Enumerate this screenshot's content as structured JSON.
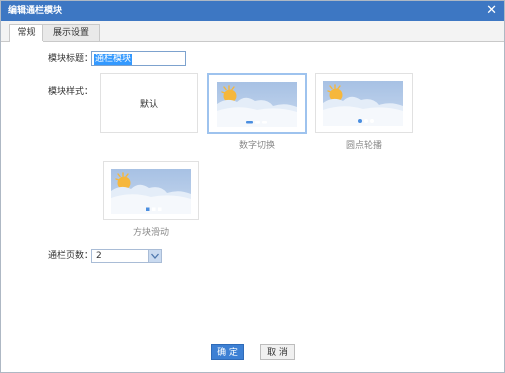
{
  "dialog": {
    "title": "编辑通栏模块"
  },
  "tabs": [
    {
      "label": "常规"
    },
    {
      "label": "展示设置"
    }
  ],
  "form": {
    "title_label": "模块标题：",
    "title_value": "通栏模块",
    "style_label": "模块样式：",
    "styles": [
      {
        "label": "默认",
        "caption": ""
      },
      {
        "label": "",
        "caption": "数字切换",
        "selected": true
      },
      {
        "label": "",
        "caption": "圆点轮播"
      },
      {
        "label": "",
        "caption": "方块滑动"
      }
    ],
    "pages_label": "通栏页数：",
    "pages_value": "2"
  },
  "buttons": {
    "ok": "确 定",
    "cancel": "取 消"
  },
  "colors": {
    "titlebar": "#3d77c3",
    "selected_border": "#9ec3ee",
    "sun": "#f6b73c",
    "ok_button": "#3d80d4"
  }
}
